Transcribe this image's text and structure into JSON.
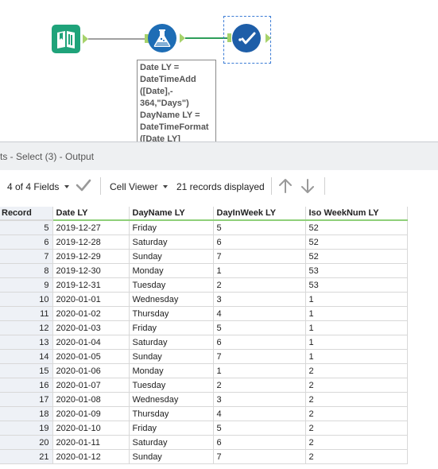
{
  "annotation": {
    "lines": [
      "Date LY =",
      "DateTimeAdd",
      "([Date],-",
      "364,\"Days\")",
      "DayName LY =",
      "DateTimeFormat",
      "([Date LY]"
    ]
  },
  "results": {
    "title": "ts - Select (3) - Output",
    "fields_label": "4 of 4 Fields",
    "viewer_label": "Cell Viewer",
    "records_label": "21 records displayed"
  },
  "table": {
    "columns": [
      "Record",
      "Date LY",
      "DayName LY",
      "DayInWeek LY",
      "Iso WeekNum LY"
    ],
    "rows": [
      [
        "5",
        "2019-12-27",
        "Friday",
        "5",
        "52"
      ],
      [
        "6",
        "2019-12-28",
        "Saturday",
        "6",
        "52"
      ],
      [
        "7",
        "2019-12-29",
        "Sunday",
        "7",
        "52"
      ],
      [
        "8",
        "2019-12-30",
        "Monday",
        "1",
        "53"
      ],
      [
        "9",
        "2019-12-31",
        "Tuesday",
        "2",
        "53"
      ],
      [
        "10",
        "2020-01-01",
        "Wednesday",
        "3",
        "1"
      ],
      [
        "11",
        "2020-01-02",
        "Thursday",
        "4",
        "1"
      ],
      [
        "12",
        "2020-01-03",
        "Friday",
        "5",
        "1"
      ],
      [
        "13",
        "2020-01-04",
        "Saturday",
        "6",
        "1"
      ],
      [
        "14",
        "2020-01-05",
        "Sunday",
        "7",
        "1"
      ],
      [
        "15",
        "2020-01-06",
        "Monday",
        "1",
        "2"
      ],
      [
        "16",
        "2020-01-07",
        "Tuesday",
        "2",
        "2"
      ],
      [
        "17",
        "2020-01-08",
        "Wednesday",
        "3",
        "2"
      ],
      [
        "18",
        "2020-01-09",
        "Thursday",
        "4",
        "2"
      ],
      [
        "19",
        "2020-01-10",
        "Friday",
        "5",
        "2"
      ],
      [
        "20",
        "2020-01-11",
        "Saturday",
        "6",
        "2"
      ],
      [
        "21",
        "2020-01-12",
        "Sunday",
        "7",
        "2"
      ]
    ]
  },
  "icons": {
    "input_tool": "book-input-icon",
    "formula_tool": "flask-formula-icon",
    "select_tool": "select-check-icon",
    "apply": "check-icon",
    "up": "arrow-up-icon",
    "down": "arrow-down-icon"
  },
  "colors": {
    "input_tool": "#1fa37a",
    "formula_tool": "#1e6db5",
    "select_tool": "#1e5ea8",
    "connector": "#2e9e5a",
    "anchor": "#a7d26b",
    "header_underline": "#8fd07a",
    "selection": "#3a7bd5"
  }
}
